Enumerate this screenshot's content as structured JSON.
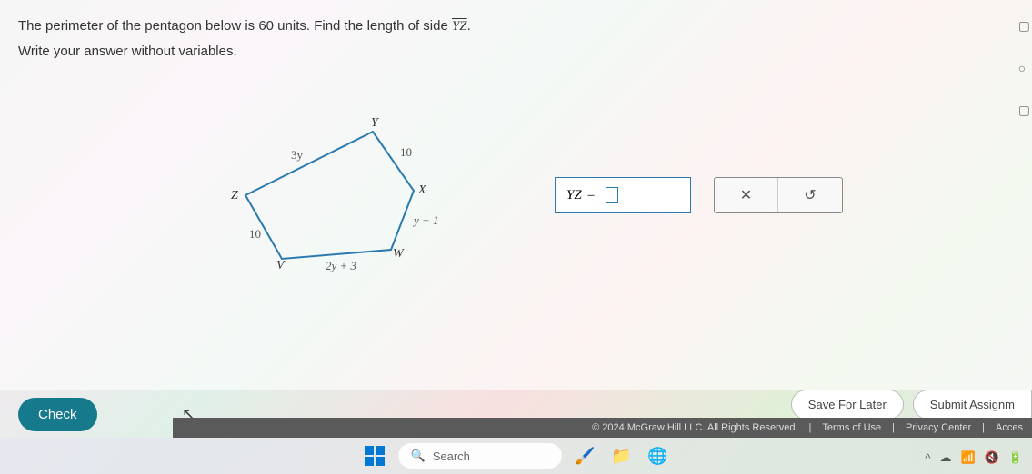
{
  "question": {
    "line1_prefix": "The perimeter of the pentagon below is ",
    "perimeter": "60",
    "line1_mid": " units. Find the length of side ",
    "target_side": "YZ",
    "line1_suffix": ".",
    "line2": "Write your answer without variables."
  },
  "figure": {
    "vertices": {
      "Y": "Y",
      "X": "X",
      "W": "W",
      "V": "V",
      "Z": "Z"
    },
    "edges": {
      "YZ": "3y",
      "YX": "10",
      "XW": "y + 1",
      "WV": "2y + 3",
      "VZ": "10"
    }
  },
  "answer": {
    "label_prefix": "YZ",
    "equals": "=",
    "value": ""
  },
  "toolbar": {
    "clear_icon": "✕",
    "reset_icon": "↺"
  },
  "actions": {
    "check": "Check",
    "save": "Save For Later",
    "submit": "Submit Assignm"
  },
  "footer": {
    "copyright": "© 2024 McGraw Hill LLC. All Rights Reserved.",
    "terms": "Terms of Use",
    "privacy": "Privacy Center",
    "access": "Acces"
  },
  "taskbar": {
    "search": "Search"
  }
}
